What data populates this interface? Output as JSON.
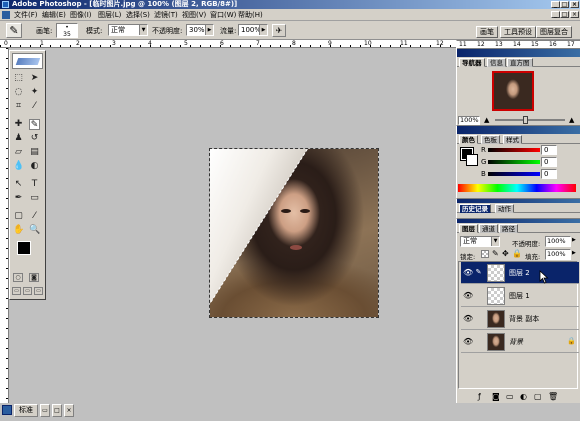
{
  "window": {
    "title": "Adobe Photoshop - [临时图片.jpg @ 100% (图层 2, RGB/8#)]"
  },
  "menu": [
    "文件(F)",
    "编辑(E)",
    "图像(I)",
    "图层(L)",
    "选择(S)",
    "滤镜(T)",
    "视图(V)",
    "窗口(W)",
    "帮助(H)"
  ],
  "options": {
    "brush_label": "画笔:",
    "brush_size": "35",
    "mode_label": "模式:",
    "mode_value": "正常",
    "opacity_label": "不透明度:",
    "opacity_value": "30%",
    "flow_label": "流量:",
    "flow_value": "100%",
    "tabs": [
      "画笔",
      "工具预设",
      "图层复合"
    ]
  },
  "ruler": {
    "top_marks": [
      "0",
      "1",
      "2",
      "3",
      "4",
      "5",
      "6",
      "7",
      "8",
      "9",
      "10",
      "11",
      "12"
    ],
    "right_marks": [
      "11",
      "12",
      "13",
      "14",
      "15",
      "16",
      "17"
    ]
  },
  "navigator": {
    "tabs": [
      "导航器",
      "信息",
      "直方图"
    ],
    "zoom": "100%"
  },
  "color": {
    "tabs": [
      "颜色",
      "色板",
      "样式"
    ],
    "labels": [
      "R",
      "G",
      "B"
    ],
    "values": [
      "0",
      "0",
      "0"
    ]
  },
  "history": {
    "tabs": [
      "历史记录",
      "动作"
    ]
  },
  "layers": {
    "tabs": [
      "图层",
      "通道",
      "路径"
    ],
    "mode": "正常",
    "opacity_label": "不透明度:",
    "opacity_value": "100%",
    "lock_label": "锁定:",
    "fill_label": "填充:",
    "fill_value": "100%",
    "items": [
      {
        "name": "图层 2",
        "active": true
      },
      {
        "name": "图层 1",
        "active": false
      },
      {
        "name": "背景 副本",
        "active": false
      },
      {
        "name": "背景",
        "active": false
      }
    ]
  },
  "status": {
    "mode": "标准"
  },
  "colors": {
    "title_start": "#0a246a",
    "selection": "#0a246a",
    "chrome": "#d4d0c8",
    "workspace": "#c0c0c0"
  }
}
